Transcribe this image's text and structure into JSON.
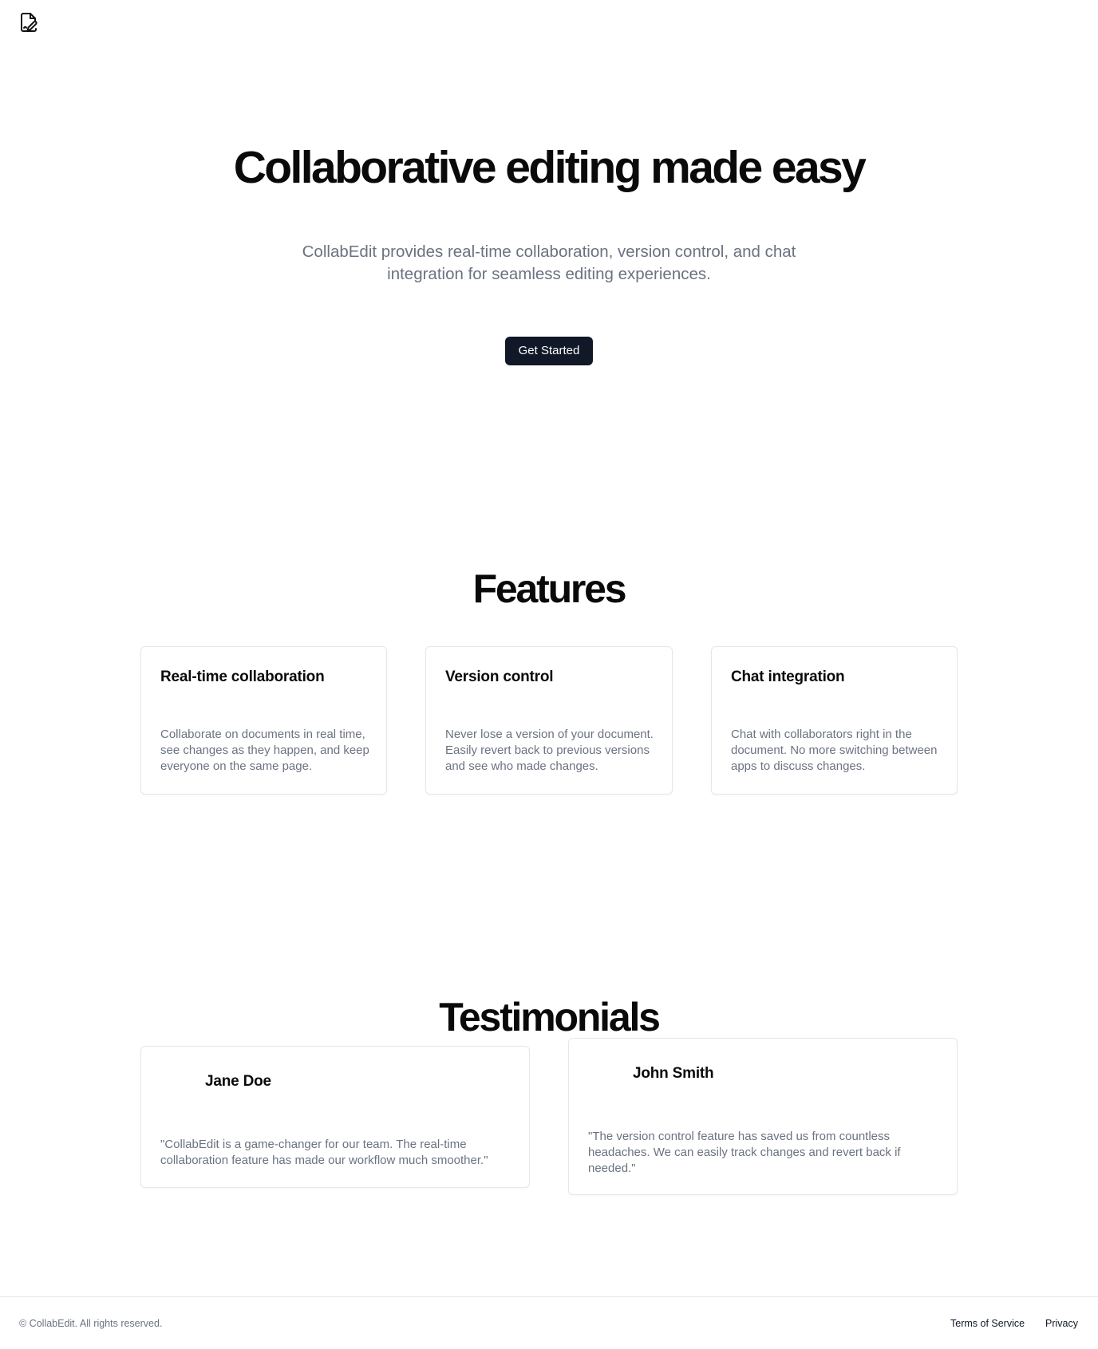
{
  "header": {
    "logo_icon": "file-signature-icon"
  },
  "hero": {
    "title": "Collaborative editing made easy",
    "subtitle": "CollabEdit provides real-time collaboration, version control, and chat integration for seamless editing experiences.",
    "cta_label": "Get Started"
  },
  "features": {
    "title": "Features",
    "items": [
      {
        "title": "Real-time collaboration",
        "description": "Collaborate on documents in real time, see changes as they happen, and keep everyone on the same page."
      },
      {
        "title": "Version control",
        "description": "Never lose a version of your document. Easily revert back to previous versions and see who made changes."
      },
      {
        "title": "Chat integration",
        "description": "Chat with collaborators right in the document. No more switching between apps to discuss changes."
      }
    ]
  },
  "testimonials": {
    "title": "Testimonials",
    "items": [
      {
        "name": "Jane Doe",
        "quote": "\"CollabEdit is a game-changer for our team. The real-time collaboration feature has made our workflow much smoother.\""
      },
      {
        "name": "John Smith",
        "quote": "\"The version control feature has saved us from countless headaches. We can easily track changes and revert back if needed.\""
      }
    ]
  },
  "footer": {
    "copyright": "© CollabEdit. All rights reserved.",
    "links": [
      {
        "label": "Terms of Service"
      },
      {
        "label": "Privacy"
      }
    ]
  },
  "colors": {
    "primary_button": "#111827",
    "muted_text": "#6b7280",
    "border": "#e5e7eb"
  }
}
